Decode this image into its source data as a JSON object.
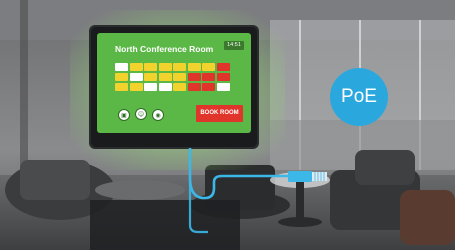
{
  "room_display": {
    "title": "North Conference Room",
    "time": "14:51",
    "book_button_label": "BOOK ROOM",
    "schedule_rows": [
      [
        "free",
        "busy",
        "busy",
        "busy",
        "busy",
        "busy",
        "busy",
        "booked"
      ],
      [
        "busy",
        "free",
        "busy",
        "busy",
        "busy",
        "booked",
        "booked",
        "booked"
      ],
      [
        "busy",
        "busy",
        "free",
        "free",
        "busy",
        "booked",
        "booked",
        "free"
      ]
    ],
    "action_icons": [
      {
        "name": "video-icon",
        "glyph": "▣"
      },
      {
        "name": "person-icon",
        "glyph": "☺"
      },
      {
        "name": "wifi-icon",
        "glyph": "◉"
      }
    ]
  },
  "badge": {
    "label": "PoE"
  },
  "colors": {
    "screen_green": "#5bb847",
    "slot_yellow": "#f2d22c",
    "slot_red": "#e0352b",
    "slot_white": "#ffffff",
    "poe_blue": "#2aa8de",
    "cable_blue": "#3bb7e8"
  }
}
